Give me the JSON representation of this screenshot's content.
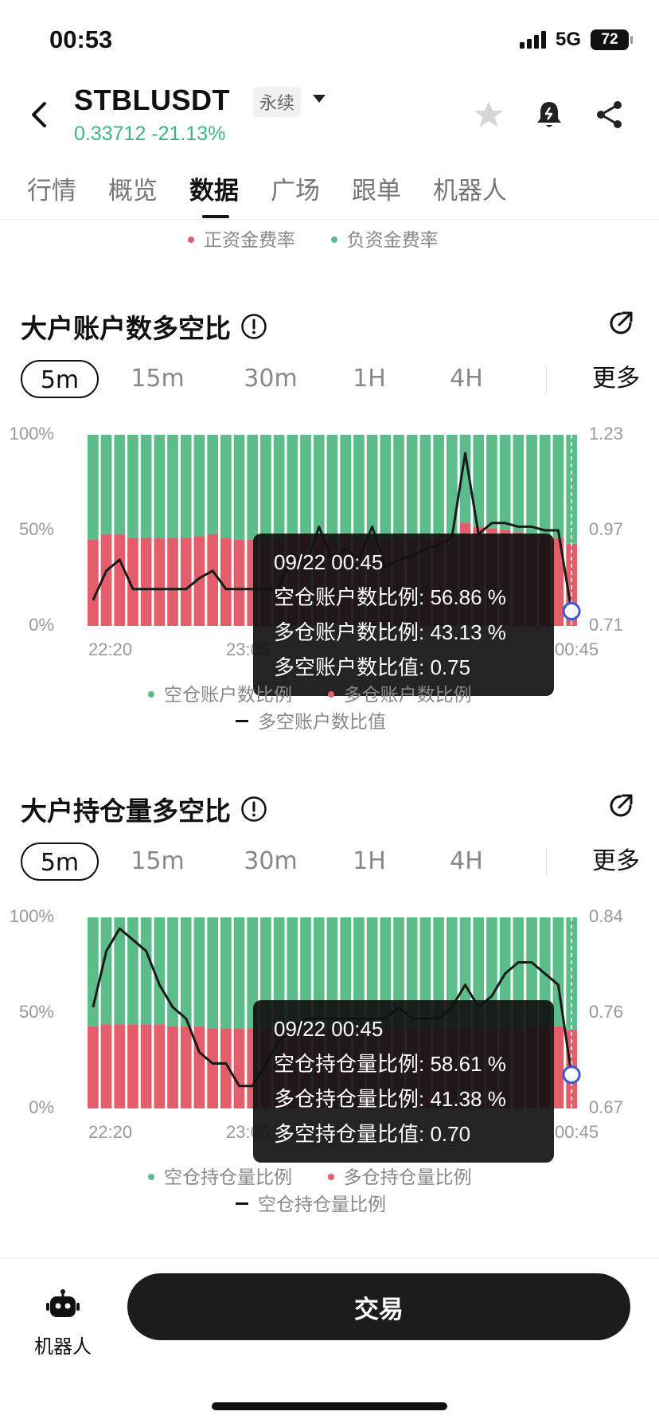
{
  "status": {
    "time": "00:53",
    "network": "5G",
    "battery": "72"
  },
  "header": {
    "symbol": "STBLUSDT",
    "contract_type": "永续",
    "price": "0.33712",
    "change": "-21.13%"
  },
  "tabs": [
    "行情",
    "概览",
    "数据",
    "广场",
    "跟单",
    "机器人"
  ],
  "active_tab": "数据",
  "funding_legend": {
    "positive": "正资金费率",
    "negative": "负资金费率"
  },
  "colors": {
    "green": "#5cbd8a",
    "red": "#e35d6a",
    "line": "#1a1a1a",
    "marker": "#3b5bdb",
    "price_green": "#3bb780"
  },
  "timeframes": [
    "5m",
    "15m",
    "30m",
    "1H",
    "4H",
    "更多"
  ],
  "account_section": {
    "title": "大户账户数多空比",
    "active_timeframe": "5m",
    "tooltip": {
      "time": "09/22 00:45",
      "short_label": "空仓账户数比例:",
      "short_value": "56.86 %",
      "long_label": "多仓账户数比例:",
      "long_value": "43.13 %",
      "ratio_label": "多空账户数比值:",
      "ratio_value": "0.75"
    },
    "legend": {
      "short": "空仓账户数比例",
      "long": "多仓账户数比例",
      "ratio": "多空账户数比值"
    }
  },
  "position_section": {
    "title": "大户持仓量多空比",
    "active_timeframe": "5m",
    "tooltip": {
      "time": "09/22 00:45",
      "short_label": "空仓持仓量比例:",
      "short_value": "58.61 %",
      "long_label": "多仓持仓量比例:",
      "long_value": "41.38 %",
      "ratio_label": "多空持仓量比值:",
      "ratio_value": "0.70"
    },
    "legend": {
      "short": "空仓持仓量比例",
      "long": "多仓持仓量比例",
      "ratio": "空仓持仓量比例"
    }
  },
  "chart_data": [
    {
      "type": "bar",
      "stacked": true,
      "left_axis": {
        "ticks": [
          "100%",
          "50%",
          "0%"
        ],
        "range": [
          0,
          100
        ]
      },
      "right_axis": {
        "ticks": [
          "1.23",
          "0.97",
          "0.71"
        ],
        "range": [
          0.71,
          1.23
        ]
      },
      "x_ticks": [
        "22:20",
        "23:05",
        "00:45"
      ],
      "long_percent": [
        45,
        48,
        48,
        46,
        46,
        46,
        46,
        46,
        47,
        48,
        46,
        45,
        45,
        45,
        45,
        48,
        48,
        48,
        45,
        48,
        45,
        45,
        45,
        46,
        46,
        46,
        47,
        48,
        54,
        52,
        51,
        50,
        49,
        48,
        47,
        46,
        43
      ],
      "ratio": [
        0.78,
        0.86,
        0.89,
        0.81,
        0.81,
        0.81,
        0.81,
        0.81,
        0.84,
        0.86,
        0.81,
        0.81,
        0.81,
        0.81,
        0.81,
        0.91,
        0.87,
        0.98,
        0.89,
        0.92,
        0.89,
        0.98,
        0.87,
        0.89,
        0.9,
        0.92,
        0.93,
        0.95,
        1.18,
        0.96,
        0.99,
        0.99,
        0.98,
        0.98,
        0.97,
        0.97,
        0.75
      ],
      "selected_index": 36
    },
    {
      "type": "bar",
      "stacked": true,
      "left_axis": {
        "ticks": [
          "100%",
          "50%",
          "0%"
        ],
        "range": [
          0,
          100
        ]
      },
      "right_axis": {
        "ticks": [
          "0.84",
          "0.76",
          "0.67"
        ],
        "range": [
          0.67,
          0.84
        ]
      },
      "x_ticks": [
        "22:20",
        "23:05",
        "00:45"
      ],
      "long_percent": [
        43,
        44,
        44,
        44,
        44,
        44,
        43,
        43,
        43,
        42,
        42,
        42,
        42,
        42,
        42,
        42,
        42,
        42,
        42,
        42,
        42,
        42,
        42,
        42,
        42,
        42,
        42,
        42,
        42,
        42,
        42,
        42,
        42,
        43,
        43,
        43,
        41
      ],
      "ratio": [
        0.76,
        0.81,
        0.83,
        0.82,
        0.81,
        0.78,
        0.76,
        0.75,
        0.72,
        0.71,
        0.71,
        0.69,
        0.69,
        0.71,
        0.73,
        0.74,
        0.75,
        0.75,
        0.75,
        0.75,
        0.75,
        0.75,
        0.75,
        0.76,
        0.75,
        0.75,
        0.75,
        0.76,
        0.78,
        0.76,
        0.77,
        0.79,
        0.8,
        0.8,
        0.79,
        0.78,
        0.7
      ],
      "selected_index": 36
    }
  ],
  "bottom_bar": {
    "robot_label": "机器人",
    "trade_label": "交易"
  }
}
